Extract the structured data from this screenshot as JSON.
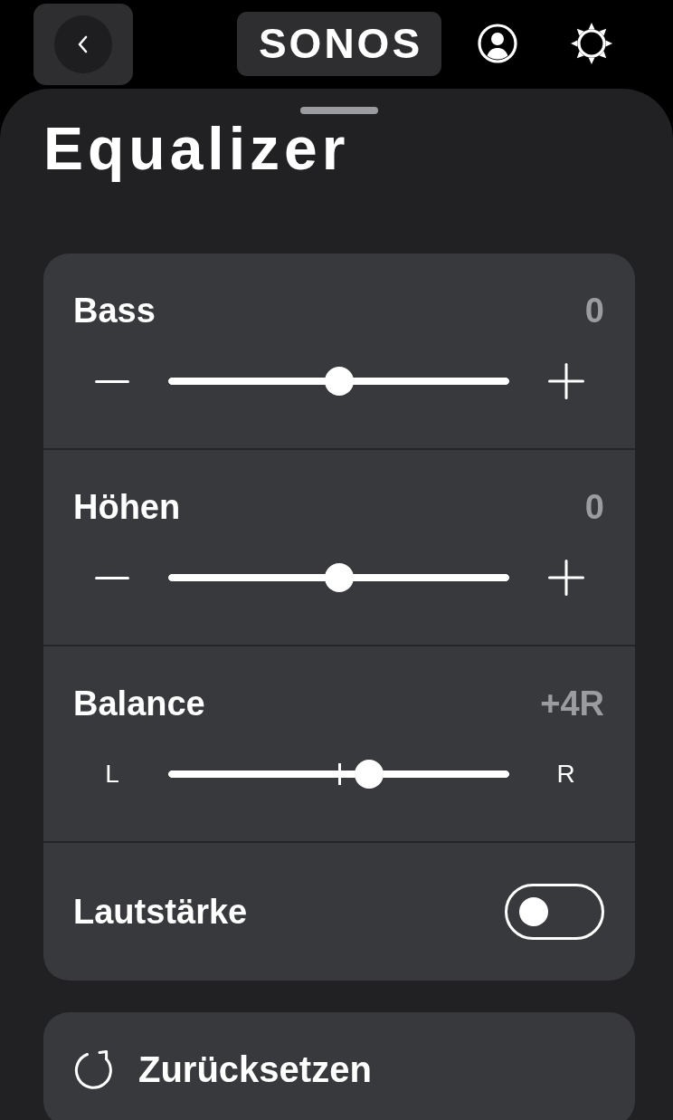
{
  "header": {
    "logo": "SONOS"
  },
  "sheet": {
    "title": "Equalizer"
  },
  "settings": [
    {
      "kind": "slider",
      "label": "Bass",
      "reading": "0",
      "level": 0.5
    },
    {
      "kind": "slider",
      "label": "Höhen",
      "reading": "0",
      "level": 0.5
    },
    {
      "kind": "balance",
      "label": "Balance",
      "reading": "+4R",
      "left_label": "L",
      "right_label": "R",
      "level": 0.59
    },
    {
      "kind": "toggle",
      "label": "Lautstärke",
      "on": false
    }
  ],
  "reset_button": {
    "label": "Zurücksetzen"
  }
}
